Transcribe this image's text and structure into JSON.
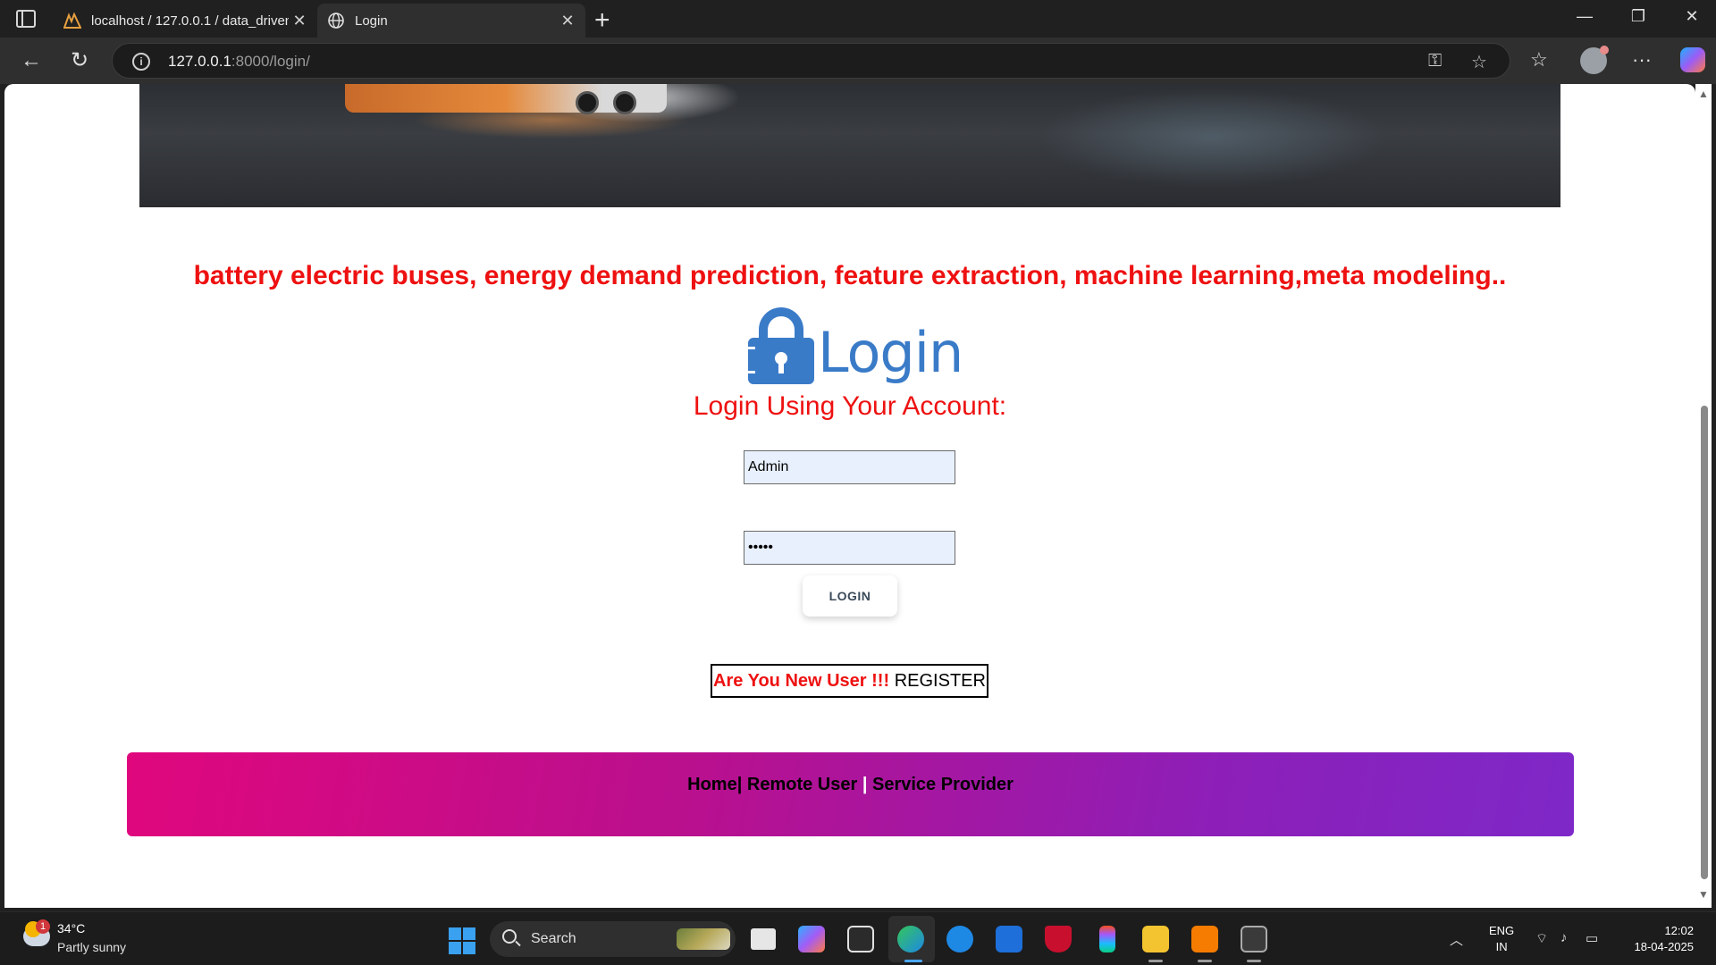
{
  "browser": {
    "tabs": [
      {
        "title": "localhost / 127.0.0.1 / data_driven",
        "active": false
      },
      {
        "title": "Login",
        "active": true
      }
    ],
    "address": {
      "host": "127.0.0.1",
      "path": ":8000/login/"
    }
  },
  "page": {
    "keywords": "battery electric buses, energy demand prediction, feature extraction, machine learning,meta modeling..",
    "logo_text": "Login",
    "subtitle": "Login Using Your Account:",
    "username_value": "Admin",
    "password_value": "•••••",
    "login_button": "LOGIN",
    "register_prompt": "Are You New User !!!",
    "register_link": "REGISTER",
    "footer": {
      "home": "Home",
      "sep1": "|",
      "remote_user": "Remote User",
      "sep2": "|",
      "service_provider": "Service Provider"
    },
    "colors": {
      "accent_red": "#ee1111",
      "logo_blue": "#3a7bc8",
      "footer_start": "#e0077d",
      "footer_end": "#7e28c8"
    }
  },
  "taskbar": {
    "weather_badge": "1",
    "temperature": "34°C",
    "weather": "Partly sunny",
    "search_placeholder": "Search",
    "lang_primary": "ENG",
    "lang_secondary": "IN",
    "time": "12:02",
    "date": "18-04-2025"
  }
}
